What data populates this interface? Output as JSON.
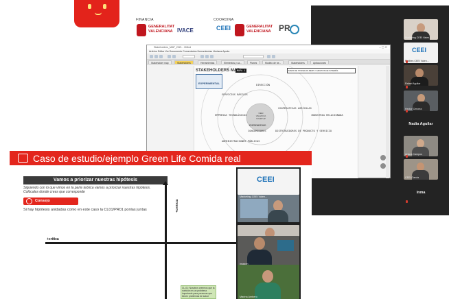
{
  "banner": {
    "financia_label": "FINANCIA",
    "coordina_label": "COORDINA",
    "generalitat_line1": "GENERALITAT",
    "generalitat_line2": "VALENCIANA",
    "ivace_label": "IVACE",
    "ceei_label": "CEEI",
    "generalitat2_line1": "GENERALITAT",
    "generalitat2_line2": "VALENCIANA",
    "pm_label": "PR"
  },
  "call_panel": {
    "participants": [
      {
        "name": "Marketing CEEI Valen..."
      },
      {
        "name": "Mailbes CEEI Valen..."
      },
      {
        "name": "Rafael Aguilar"
      },
      {
        "name": "Hector Cervera"
      },
      {
        "name": "Nadia Aguilar"
      },
      {
        "name": "Ariana Campos"
      },
      {
        "name": "CEEI Garcia"
      },
      {
        "name": "Inma"
      }
    ]
  },
  "app_window": {
    "title": "Stakeholders_MAP_2021 - XMind",
    "menu": "Archivo  Editar  Ver  Documento  Comentarios  Herramientas  Ventana  Ayuda",
    "tabs": [
      "Stakeholder map",
      "Stakeholders",
      "Herramientas",
      "Elementos y ca...",
      "Planes",
      "Modelo de ne...",
      "Stakeholders",
      "Aplicaciones"
    ],
    "active_tab_index": 1,
    "mindmap": {
      "title": "STAKEHOLDERS MAP",
      "tag": "EXPERIMENTAL",
      "top_label": "MAPA 1",
      "top_note": "MAPA DE STAKEHOLDERS / GRUPOS DE INTERÉS",
      "center": [
        "CEEI",
        "VALENCIA",
        "STARTUP"
      ],
      "nodes": [
        "DIRECCIÓN",
        "SERVICIOS BÁSICOS",
        "COOPERATIVAS AGRÍCOLAS",
        "EMPRESAS TECNOLÓGICAS",
        "INDUSTRIA RELACIONADA",
        "EMPRENDEDOR",
        "CONSUMIDORES",
        "DISTRIBUIDORES DE PRODUCTO Y SERVICIO",
        "ADMINISTRACIONES PÚBLICAS"
      ]
    }
  },
  "slide": {
    "title": "Caso de estudio/ejemplo   Green Life Comida real",
    "subheader": "Vamos a priorizar nuestras hipótesis",
    "intro_line1": "Siguiendo con lo que vimos en la parte teórica vamos a priorizar nuestras hipótesis.",
    "intro_line2": "Colócalas donde creas que corresponde",
    "consejo_label": "Consejo",
    "note": "Si hay hipótesis anidadas como en este caso la CL01/PR01 ponlas juntas",
    "axis_vertical_label": "+certeza",
    "axis_horizontal_label": "+crítica",
    "sticky_text": "CL-01: Nosotros creemos que la nutrición es un problema importante para personas que tienen problemas de salud"
  },
  "video_strip": {
    "tiles": [
      {
        "name": "CEEI"
      },
      {
        "name": "Marketing CEEI Valen..."
      },
      {
        "name": "julian cerezo"
      },
      {
        "name": "imagen"
      },
      {
        "name": "Marina Ambero"
      }
    ]
  },
  "colors": {
    "slide_red": "#e3261d",
    "panel_dark": "#232323",
    "tab_active": "#f6d35a"
  }
}
